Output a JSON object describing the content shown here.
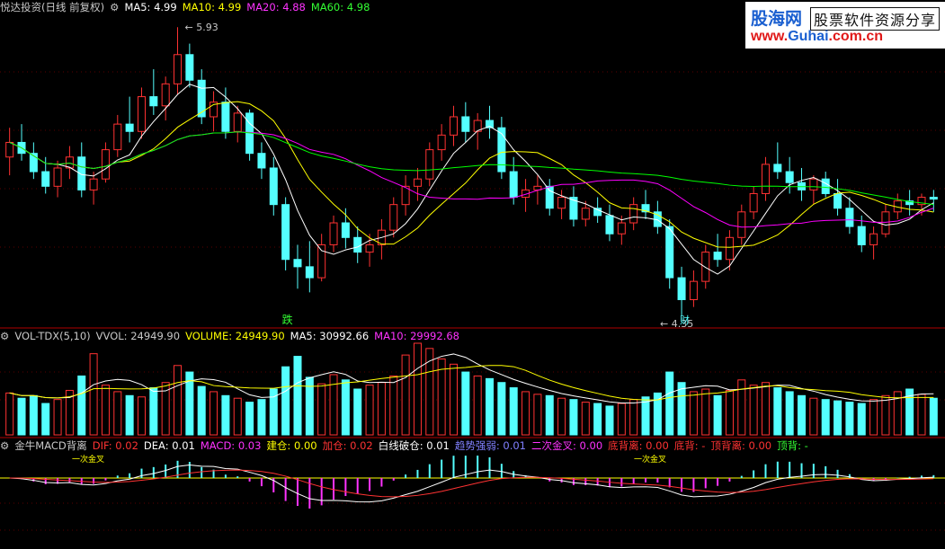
{
  "panel_price": {
    "title": "悦达投资(日线 前复权)",
    "ma5": "MA5: 4.99",
    "ma10": "MA10: 4.99",
    "ma20": "MA20: 4.88",
    "ma60": "MA60: 4.98",
    "high_label": "5.93",
    "low_label": "4.35",
    "mark_die": "跌",
    "mark_cai": "财"
  },
  "panel_vol": {
    "title": "VOL-TDX(5,10)",
    "vvol": "VVOL: 24949.90",
    "volume": "VOLUME: 24949.90",
    "ma5": "MA5: 30992.66",
    "ma10": "MA10: 29992.68"
  },
  "panel_macd": {
    "title": "金牛MACD背离",
    "dif": "DIF: 0.02",
    "dea": "DEA: 0.01",
    "macd": "MACD: 0.03",
    "jiancang": "建仓: 0.00",
    "jiacang": "加仓: 0.02",
    "baixian": "白线破仓: 0.01",
    "qushi": "趋势强弱: 0.01",
    "erci": "二次金叉: 0.00",
    "dibeili": "底背离: 0.00",
    "dibei": "底背: -",
    "dingbeili": "顶背离: 0.00",
    "dingbei": "顶背: -",
    "cross_label": "一次金叉"
  },
  "logo": {
    "cn": "股海网",
    "cn2": "股票软件资源分享",
    "url_red": "www.",
    "url_blue": "Guhai",
    "url_red2": ".com.cn"
  },
  "colors": {
    "up": "#ff3232",
    "down": "#54ffff",
    "ma5": "#ffffff",
    "ma10": "#ffff00",
    "ma20": "#ff00ff",
    "ma60": "#00ff00",
    "panel_line": "#b00000"
  },
  "chart_data": {
    "type": "candlestick",
    "ohlc": [
      [
        5.22,
        5.38,
        5.12,
        5.3
      ],
      [
        5.3,
        5.4,
        5.2,
        5.24
      ],
      [
        5.24,
        5.3,
        5.1,
        5.14
      ],
      [
        5.14,
        5.22,
        5.02,
        5.06
      ],
      [
        5.06,
        5.2,
        5.0,
        5.16
      ],
      [
        5.16,
        5.28,
        5.1,
        5.22
      ],
      [
        5.22,
        5.3,
        5.0,
        5.04
      ],
      [
        5.04,
        5.14,
        4.96,
        5.1
      ],
      [
        5.1,
        5.3,
        5.08,
        5.26
      ],
      [
        5.26,
        5.45,
        5.22,
        5.4
      ],
      [
        5.4,
        5.55,
        5.3,
        5.36
      ],
      [
        5.36,
        5.6,
        5.32,
        5.55
      ],
      [
        5.55,
        5.7,
        5.45,
        5.5
      ],
      [
        5.5,
        5.66,
        5.42,
        5.62
      ],
      [
        5.62,
        5.93,
        5.56,
        5.78
      ],
      [
        5.78,
        5.84,
        5.6,
        5.64
      ],
      [
        5.64,
        5.7,
        5.4,
        5.44
      ],
      [
        5.44,
        5.58,
        5.36,
        5.52
      ],
      [
        5.52,
        5.6,
        5.32,
        5.36
      ],
      [
        5.36,
        5.5,
        5.3,
        5.46
      ],
      [
        5.46,
        5.48,
        5.2,
        5.24
      ],
      [
        5.24,
        5.3,
        5.1,
        5.16
      ],
      [
        5.16,
        5.22,
        4.9,
        4.96
      ],
      [
        4.96,
        5.0,
        4.6,
        4.66
      ],
      [
        4.66,
        4.74,
        4.5,
        4.62
      ],
      [
        4.62,
        4.76,
        4.48,
        4.56
      ],
      [
        4.56,
        4.8,
        4.54,
        4.74
      ],
      [
        4.74,
        4.9,
        4.7,
        4.86
      ],
      [
        4.86,
        4.94,
        4.72,
        4.78
      ],
      [
        4.78,
        4.84,
        4.64,
        4.7
      ],
      [
        4.7,
        4.8,
        4.62,
        4.74
      ],
      [
        4.74,
        4.88,
        4.66,
        4.82
      ],
      [
        4.82,
        5.0,
        4.78,
        4.96
      ],
      [
        4.96,
        5.12,
        4.9,
        5.06
      ],
      [
        5.06,
        5.16,
        4.98,
        5.1
      ],
      [
        5.1,
        5.3,
        5.06,
        5.26
      ],
      [
        5.26,
        5.4,
        5.2,
        5.34
      ],
      [
        5.34,
        5.5,
        5.28,
        5.44
      ],
      [
        5.44,
        5.52,
        5.3,
        5.36
      ],
      [
        5.36,
        5.46,
        5.26,
        5.42
      ],
      [
        5.42,
        5.5,
        5.32,
        5.38
      ],
      [
        5.38,
        5.44,
        5.1,
        5.14
      ],
      [
        5.14,
        5.22,
        4.96,
        5.0
      ],
      [
        5.0,
        5.1,
        4.92,
        5.04
      ],
      [
        5.04,
        5.12,
        4.96,
        5.06
      ],
      [
        5.06,
        5.1,
        4.9,
        4.94
      ],
      [
        4.94,
        5.04,
        4.88,
        5.0
      ],
      [
        5.0,
        5.06,
        4.84,
        4.88
      ],
      [
        4.88,
        4.98,
        4.84,
        4.94
      ],
      [
        4.94,
        5.0,
        4.86,
        4.9
      ],
      [
        4.9,
        4.96,
        4.76,
        4.8
      ],
      [
        4.8,
        4.9,
        4.74,
        4.86
      ],
      [
        4.86,
        5.0,
        4.82,
        4.96
      ],
      [
        4.96,
        5.04,
        4.88,
        4.92
      ],
      [
        4.92,
        4.98,
        4.8,
        4.84
      ],
      [
        4.84,
        4.88,
        4.5,
        4.56
      ],
      [
        4.56,
        4.62,
        4.35,
        4.44
      ],
      [
        4.44,
        4.6,
        4.4,
        4.54
      ],
      [
        4.54,
        4.74,
        4.5,
        4.7
      ],
      [
        4.7,
        4.8,
        4.62,
        4.66
      ],
      [
        4.66,
        4.82,
        4.6,
        4.78
      ],
      [
        4.78,
        4.96,
        4.74,
        4.92
      ],
      [
        4.92,
        5.06,
        4.88,
        5.02
      ],
      [
        5.02,
        5.22,
        4.98,
        5.18
      ],
      [
        5.18,
        5.3,
        5.1,
        5.14
      ],
      [
        5.14,
        5.22,
        5.02,
        5.08
      ],
      [
        5.08,
        5.16,
        4.98,
        5.04
      ],
      [
        5.04,
        5.12,
        4.96,
        5.1
      ],
      [
        5.1,
        5.14,
        5.0,
        5.02
      ],
      [
        5.02,
        5.1,
        4.9,
        4.94
      ],
      [
        4.94,
        5.0,
        4.8,
        4.84
      ],
      [
        4.84,
        4.9,
        4.7,
        4.74
      ],
      [
        4.74,
        4.84,
        4.66,
        4.8
      ],
      [
        4.8,
        4.96,
        4.78,
        4.92
      ],
      [
        4.92,
        5.02,
        4.88,
        4.98
      ],
      [
        4.98,
        5.04,
        4.9,
        4.96
      ],
      [
        4.96,
        5.02,
        4.9,
        5.0
      ],
      [
        5.0,
        5.04,
        4.92,
        4.99
      ]
    ],
    "volume": [
      32,
      28,
      30,
      24,
      27,
      34,
      45,
      62,
      38,
      33,
      30,
      29,
      36,
      40,
      53,
      48,
      37,
      33,
      30,
      28,
      25,
      27,
      35,
      52,
      60,
      44,
      39,
      46,
      42,
      35,
      38,
      40,
      45,
      61,
      70,
      66,
      58,
      54,
      48,
      45,
      43,
      40,
      36,
      33,
      31,
      30,
      28,
      27,
      25,
      24,
      22,
      24,
      27,
      29,
      32,
      48,
      40,
      33,
      35,
      30,
      34,
      42,
      38,
      40,
      36,
      33,
      30,
      28,
      27,
      26,
      25,
      24,
      27,
      30,
      33,
      35,
      31,
      28
    ],
    "ma5": "4.99",
    "ma10": "4.99",
    "ma20": "4.88",
    "ma60": "4.98",
    "high": 5.93,
    "low": 4.35,
    "ylim": [
      4.3,
      6.0
    ]
  }
}
